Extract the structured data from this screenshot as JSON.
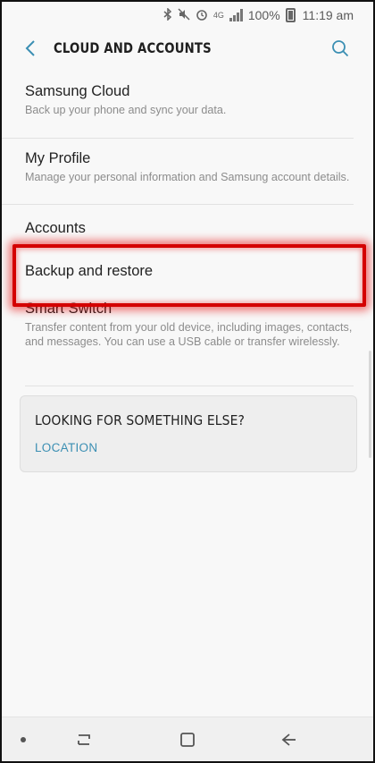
{
  "status_bar": {
    "network": "4G",
    "battery_text": "100%",
    "time": "11:19 am"
  },
  "header": {
    "title": "CLOUD AND ACCOUNTS"
  },
  "menu": {
    "samsung_cloud": {
      "title": "Samsung Cloud",
      "description": "Back up your phone and sync your data."
    },
    "my_profile": {
      "title": "My Profile",
      "description": "Manage your personal information and Samsung account details."
    },
    "accounts": {
      "title": "Accounts"
    },
    "backup_restore": {
      "title": "Backup and restore"
    },
    "smart_switch": {
      "title": "Smart Switch",
      "description": "Transfer content from your old device, including images, contacts, and messages. You can use a USB cable or transfer wirelessly."
    }
  },
  "suggestion": {
    "title": "LOOKING FOR SOMETHING ELSE?",
    "link": "LOCATION"
  },
  "colors": {
    "accent": "#3b8fb3",
    "highlight": "#d40000"
  }
}
